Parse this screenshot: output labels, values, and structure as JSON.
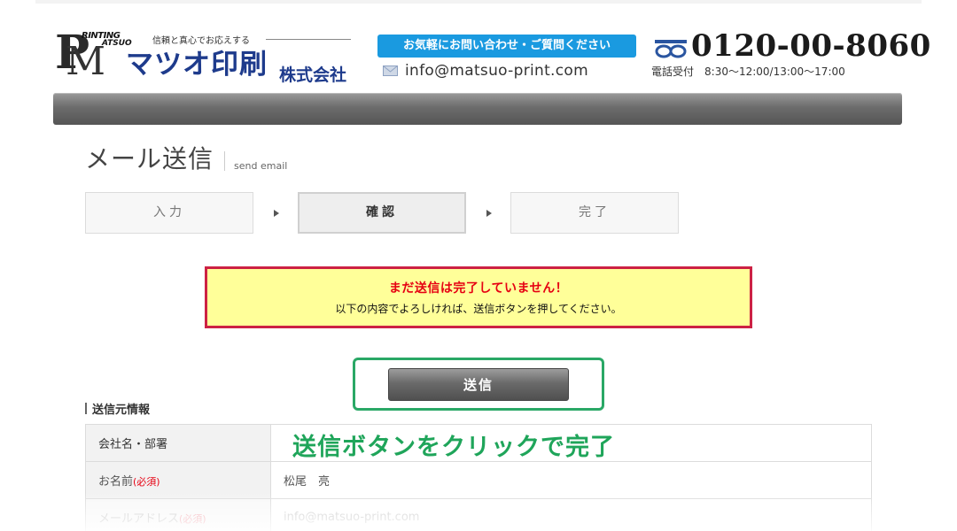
{
  "header": {
    "logo": {
      "mark_p": "P",
      "mark_m": "M",
      "printing": "RINTING",
      "atsuo": "ATSUO",
      "tagline": "信頼と真心でお応えする",
      "company": "マツオ印刷",
      "suffix": "株式会社"
    },
    "contact_button": "お気軽にお問い合わせ・ご質問ください",
    "email": "info@matsuo-print.com",
    "phone": {
      "number": "0120-00-8060",
      "hours_label": "電話受付",
      "hours": "8:30～12:00/13:00～17:00"
    }
  },
  "page": {
    "title": "メール送信",
    "title_en": "send email"
  },
  "steps": [
    {
      "label": "入力"
    },
    {
      "label": "確認"
    },
    {
      "label": "完了"
    }
  ],
  "warning": {
    "line1": "まだ送信は完了していません！",
    "line2": "以下の内容でよろしければ、送信ボタンを押してください。"
  },
  "submit_label": "送信",
  "callout": "送信ボタンをクリックで完了",
  "section_title": "送信元情報",
  "form_rows": [
    {
      "label": "会社名・部署",
      "required": "",
      "value": ""
    },
    {
      "label": "お名前",
      "required": "(必須)",
      "value": "松尾　亮"
    },
    {
      "label": "メールアドレス",
      "required": "(必須)",
      "value": "info@matsuo-print.com"
    }
  ],
  "colors": {
    "brand": "#1e3b8c",
    "contact_blue": "#1a9ae0",
    "warning_red": "#e60012",
    "warning_bg": "#ffff99",
    "highlight_green": "#2aa866"
  }
}
